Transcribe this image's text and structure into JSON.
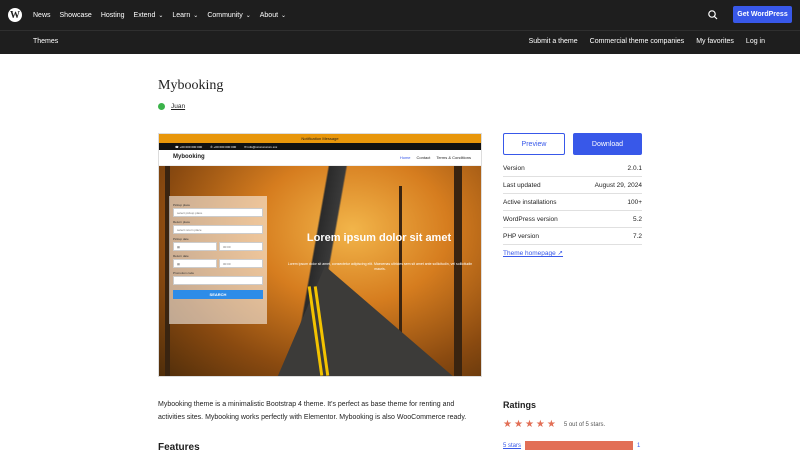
{
  "topnav": {
    "items": [
      {
        "label": "News",
        "dropdown": false
      },
      {
        "label": "Showcase",
        "dropdown": false
      },
      {
        "label": "Hosting",
        "dropdown": false
      },
      {
        "label": "Extend",
        "dropdown": true
      },
      {
        "label": "Learn",
        "dropdown": true
      },
      {
        "label": "Community",
        "dropdown": true
      },
      {
        "label": "About",
        "dropdown": true
      }
    ],
    "cta_label": "Get WordPress"
  },
  "subnav": {
    "title": "Themes",
    "links": [
      "Submit a theme",
      "Commercial theme companies",
      "My favorites",
      "Log in"
    ]
  },
  "theme": {
    "title": "Mybooking",
    "author": "Juan"
  },
  "preview": {
    "notification": "Notification Message",
    "info": [
      "+00 000 000 000",
      "+00 000 000 000",
      "info@xxxxxxxxxxx.xxx"
    ],
    "site_logo": "Mybooking",
    "menu": [
      "Home",
      "Contact",
      "Terms & Conditions"
    ],
    "form": {
      "pickup_label": "Pickup place",
      "pickup_placeholder": "select pickup place",
      "return_label": "Return place",
      "return_placeholder": "select return place",
      "pickup_date_label": "Pickup date",
      "return_date_label": "Return date",
      "time_placeholder": "00:00",
      "promo_label": "Promotion code",
      "search_label": "SEARCH"
    },
    "hero_title": "Lorem ipsum dolor sit amet",
    "hero_sub": "Lorem ipsum dolor sit amet, consectetur adipiscing elit. Maecenas ultricies sem sit amet ante sollicitudin, vel sollicitudin mauris."
  },
  "actions": {
    "preview": "Preview",
    "download": "Download"
  },
  "meta": [
    {
      "key": "Version",
      "value": "2.0.1"
    },
    {
      "key": "Last updated",
      "value": "August 29, 2024"
    },
    {
      "key": "Active installations",
      "value": "100+"
    },
    {
      "key": "WordPress version",
      "value": "5.2"
    },
    {
      "key": "PHP version",
      "value": "7.2"
    }
  ],
  "theme_homepage": "Theme homepage ↗",
  "description": "Mybooking theme is a minimalistic Bootstrap 4 theme. It's perfect as base theme for renting and activities sites. Mybooking works perfectly with Elementor. Mybooking is also WooCommerce ready.",
  "features_heading": "Features",
  "ratings": {
    "title": "Ratings",
    "stars": 5,
    "summary": "5 out of 5 stars.",
    "bars": [
      {
        "label": "5 stars",
        "fraction": 1.0,
        "count": "1"
      }
    ]
  },
  "colors": {
    "accent": "#3858e9",
    "nav_bg": "#1e1e1e",
    "star": "#e26f56"
  }
}
